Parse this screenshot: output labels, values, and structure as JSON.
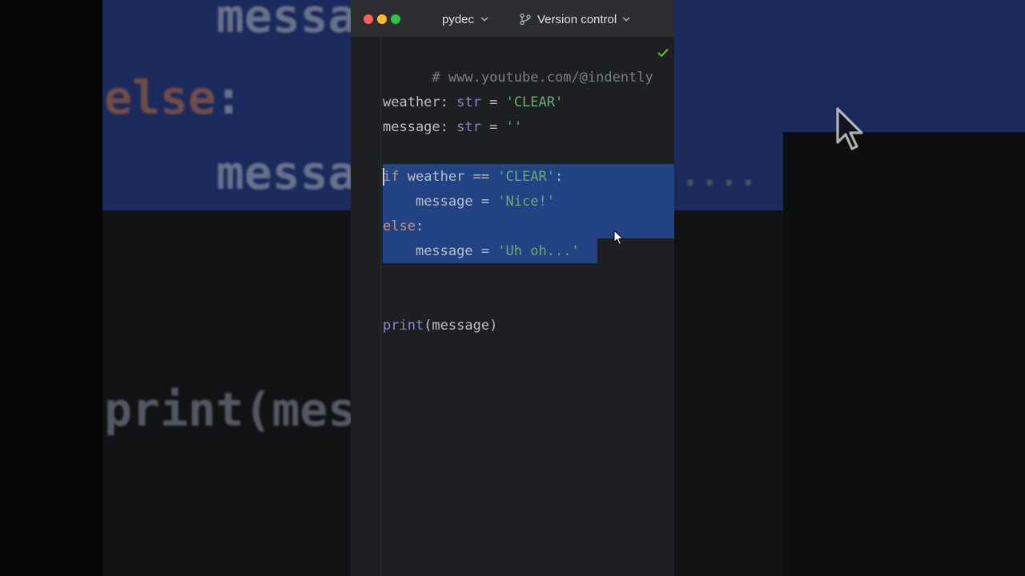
{
  "window": {
    "project_name": "pydec",
    "vcs_label": "Version control"
  },
  "editor": {
    "comment": "# www.youtube.com/@indently",
    "lines": {
      "l3": {
        "name": "weather",
        "sep": ": ",
        "type": "str",
        "eq": " = ",
        "value": "'CLEAR'"
      },
      "l4": {
        "name": "message",
        "sep": ": ",
        "type": "str",
        "eq": " = ",
        "value": "''"
      },
      "l6": {
        "kw": "if",
        "rest": " weather == ",
        "value": "'CLEAR'",
        "end": ":"
      },
      "l7": {
        "indent": "    ",
        "text": "message = ",
        "value": "'Nice!'"
      },
      "l8": {
        "kw": "else",
        "end": ":"
      },
      "l9": {
        "indent": "    ",
        "text": "message = ",
        "value": "'Uh oh...'"
      },
      "l12": {
        "fn": "print",
        "args": "(message)"
      }
    }
  },
  "backdrop": {
    "msg_text": "messa",
    "else_text": "else",
    "colon": ":",
    "print_text": "print(mes",
    "dots": "...."
  },
  "icons": {
    "check": "checkmark-icon",
    "branch": "branch-icon",
    "chevron": "chevron-down-icon",
    "cursor": "mouse-pointer-icon"
  },
  "colors": {
    "editor_bg": "#1e1f22",
    "selection": "#214283",
    "keyword": "#cf8e6d",
    "string": "#6aab73",
    "builtin": "#8888c6",
    "check": "#5fb832"
  }
}
